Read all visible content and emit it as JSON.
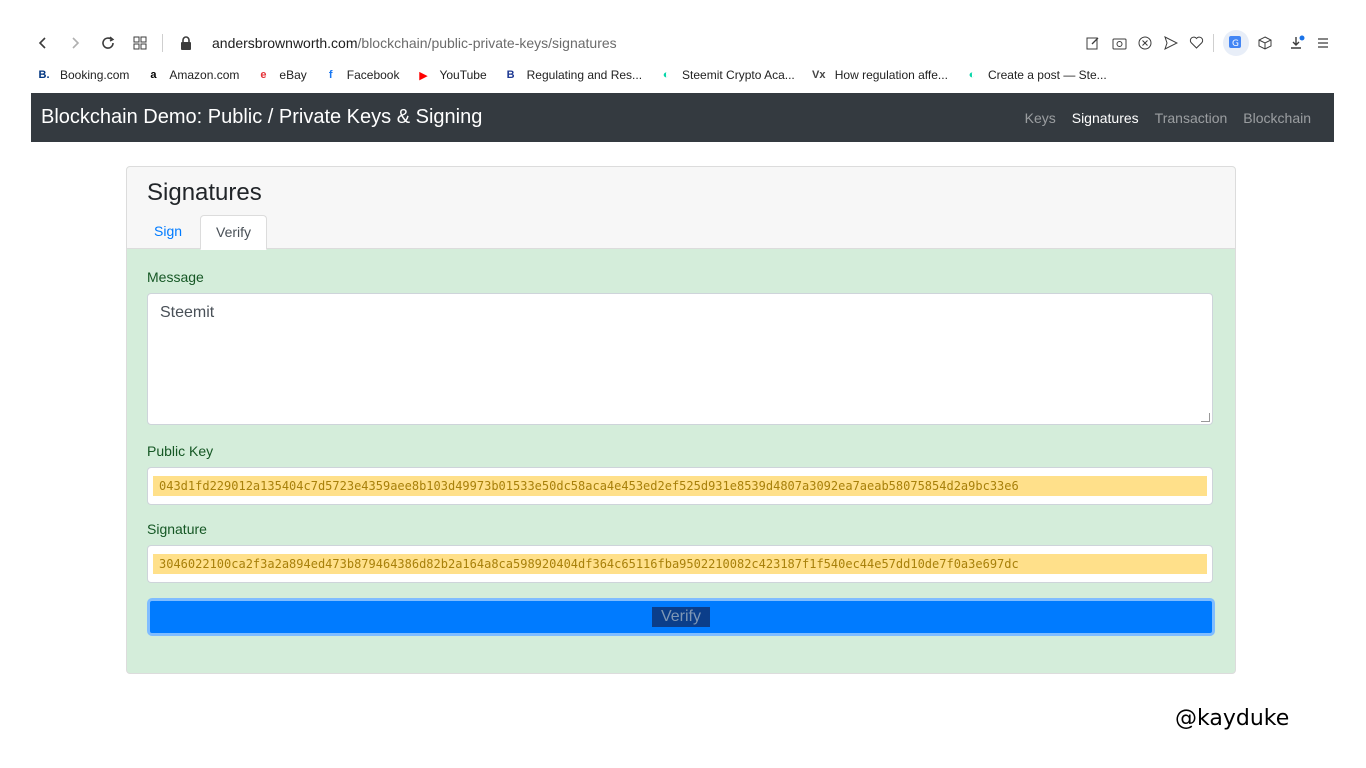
{
  "browser": {
    "url_host": "andersbrownworth.com",
    "url_path": "/blockchain/public-private-keys/signatures",
    "bookmarks": [
      {
        "label": "Booking.com",
        "icon": "booking-icon",
        "color": "#003580",
        "glyph": "B."
      },
      {
        "label": "Amazon.com",
        "icon": "amazon-icon",
        "color": "#000000",
        "glyph": "a"
      },
      {
        "label": "eBay",
        "icon": "ebay-icon",
        "color": "#e53238",
        "glyph": "e"
      },
      {
        "label": "Facebook",
        "icon": "facebook-icon",
        "color": "#1877f2",
        "glyph": "f"
      },
      {
        "label": "YouTube",
        "icon": "youtube-icon",
        "color": "#ff0000",
        "glyph": "▶"
      },
      {
        "label": "Regulating and Res...",
        "icon": "bookmark-b-icon",
        "color": "#1f3a93",
        "glyph": "B"
      },
      {
        "label": "Steemit Crypto Aca...",
        "icon": "steemit-icon",
        "color": "#06d6a9",
        "glyph": "◐"
      },
      {
        "label": "How regulation affe...",
        "icon": "vox-icon",
        "color": "#444444",
        "glyph": "Vx"
      },
      {
        "label": "Create a post — Ste...",
        "icon": "steemit-icon",
        "color": "#06d6a9",
        "glyph": "◐"
      }
    ]
  },
  "navbar": {
    "brand": "Blockchain Demo: Public / Private Keys & Signing",
    "links": [
      "Keys",
      "Signatures",
      "Transaction",
      "Blockchain"
    ],
    "active": "Signatures"
  },
  "card": {
    "title": "Signatures",
    "tabs": [
      "Sign",
      "Verify"
    ],
    "active_tab": "Verify",
    "message_label": "Message",
    "message_value": "Steemit",
    "public_key_label": "Public Key",
    "public_key_value": "043d1fd229012a135404c7d5723e4359aee8b103d49973b01533e50dc58aca4e453ed2ef525d931e8539d4807a3092ea7aeab58075854d2a9bc33e6",
    "signature_label": "Signature",
    "signature_value": "3046022100ca2f3a2a894ed473b879464386d82b2a164a8ca598920404df364c65116fba9502210082c423187f1f540ec44e57dd10de7f0a3e697dc",
    "verify_button": "Verify"
  },
  "watermark": "@kayduke",
  "colors": {
    "navbar_bg": "#343a40",
    "card_bg": "#d4edda",
    "button_primary": "#007bff",
    "highlight": "#ffe08a"
  }
}
